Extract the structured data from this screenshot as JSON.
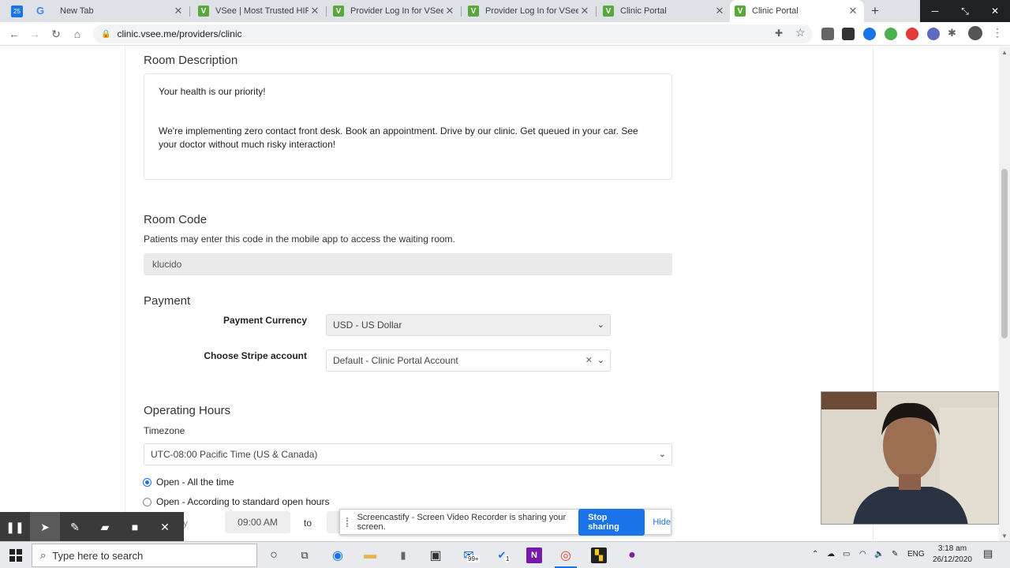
{
  "browser": {
    "tabs": [
      {
        "title": "New Tab",
        "favicon": "google-icon"
      },
      {
        "title": "VSee | Most Trusted HIPAA",
        "favicon": "vsee-icon"
      },
      {
        "title": "Provider Log In for VSee C",
        "favicon": "vsee-icon"
      },
      {
        "title": "Provider Log In for VSee C",
        "favicon": "vsee-icon"
      },
      {
        "title": "Clinic Portal",
        "favicon": "vsee-icon"
      },
      {
        "title": "Clinic Portal",
        "favicon": "vsee-icon"
      }
    ],
    "active_tab": 5,
    "url": "clinic.vsee.me/providers/clinic"
  },
  "page": {
    "room_description": {
      "heading": "Room Description",
      "line1": "Your health is our priority!",
      "line2": "We're implementing zero contact front desk. Book an appointment. Drive by our clinic. Get queued in your car. See your doctor without much risky interaction!"
    },
    "room_code": {
      "heading": "Room Code",
      "hint": "Patients may enter this code in the mobile app to access the waiting room.",
      "value": "klucido"
    },
    "payment": {
      "heading": "Payment",
      "currency_label": "Payment Currency",
      "currency_value": "USD - US Dollar",
      "stripe_label": "Choose Stripe account",
      "stripe_value": "Default - Clinic Portal Account"
    },
    "operating_hours": {
      "heading": "Operating Hours",
      "timezone_label": "Timezone",
      "timezone_value": "UTC-08:00 Pacific Time (US & Canada)",
      "option_all": "Open - All the time",
      "option_standard": "Open - According to standard open hours",
      "day_partial": "y",
      "start_time": "09:00 AM",
      "to_label": "to"
    }
  },
  "screencastify": {
    "message": "Screencastify - Screen Video Recorder is sharing your screen.",
    "stop_label": "Stop sharing",
    "hide_label": "Hide"
  },
  "taskbar": {
    "search_placeholder": "Type here to search",
    "lang": "ENG",
    "time": "3:18 am",
    "date": "26/12/2020",
    "badge_mail": "99+",
    "badge_todo": "1"
  }
}
